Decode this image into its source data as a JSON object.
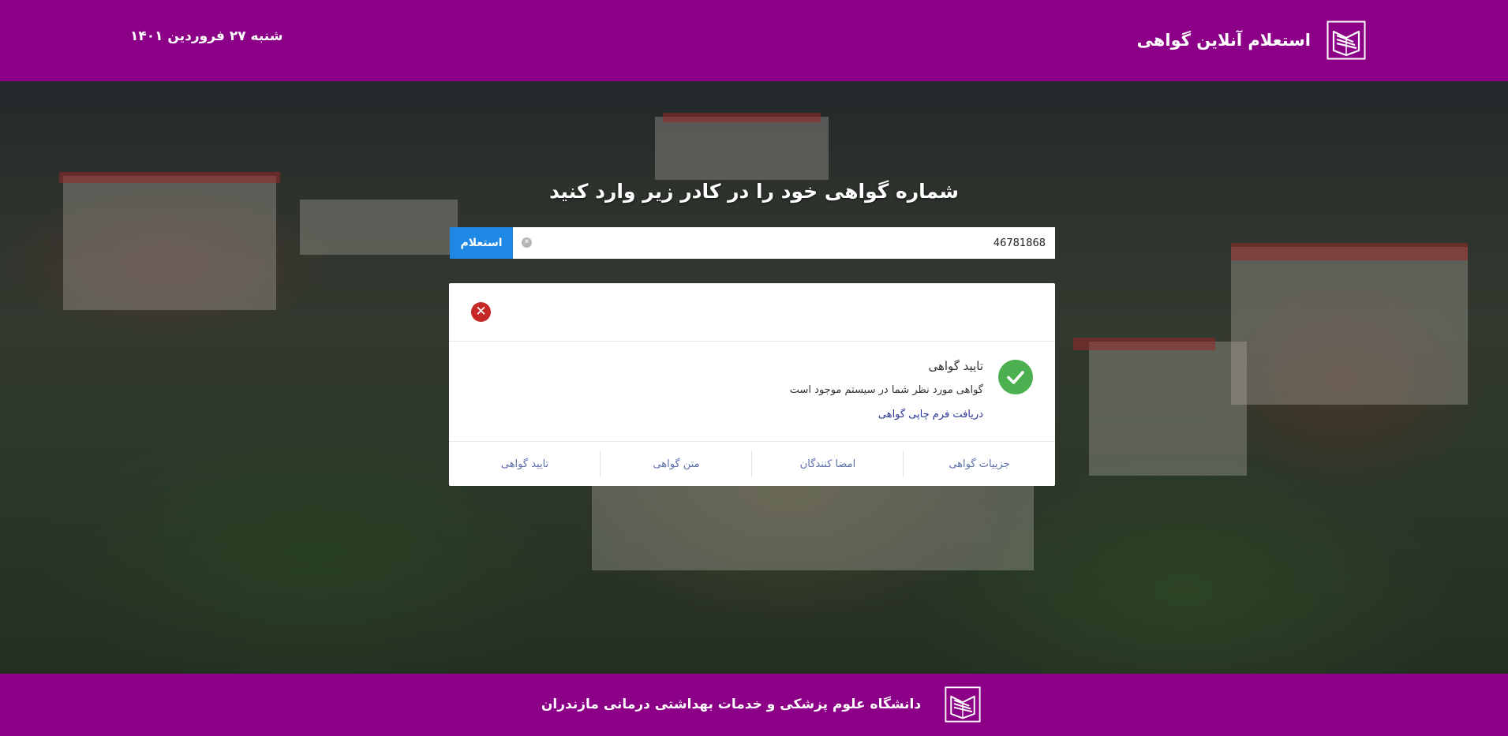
{
  "header": {
    "title": "استعلام آنلاین گواهی",
    "date": "شنبه ۲۷ فروردین ۱۴۰۱",
    "logo_icon": "open-book-logo-icon"
  },
  "hero": {
    "headline": "شماره گواهی خود را در کادر زیر وارد کنید"
  },
  "search": {
    "value": "46781868",
    "button_label": "استعلام",
    "clear_icon": "clear-circle-icon"
  },
  "result": {
    "close_icon": "close-circle-icon",
    "status_icon": "check-circle-icon",
    "title": "تایید گواهی",
    "message": "گواهی مورد نظر شما در سیستم موجود است",
    "link": "دریافت فرم چاپی گواهی",
    "tabs": [
      {
        "label": "جزییات گواهی"
      },
      {
        "label": "امضا کنندگان"
      },
      {
        "label": "متن گواهی"
      },
      {
        "label": "تایید گواهی"
      }
    ]
  },
  "footer": {
    "title": "دانشگاه علوم پزشکی و خدمات بهداشتی درمانی مازندران"
  },
  "colors": {
    "brand": "#8b0087",
    "button": "#1e88e5",
    "success": "#4caf50",
    "error": "#c62828",
    "link": "#283593"
  }
}
